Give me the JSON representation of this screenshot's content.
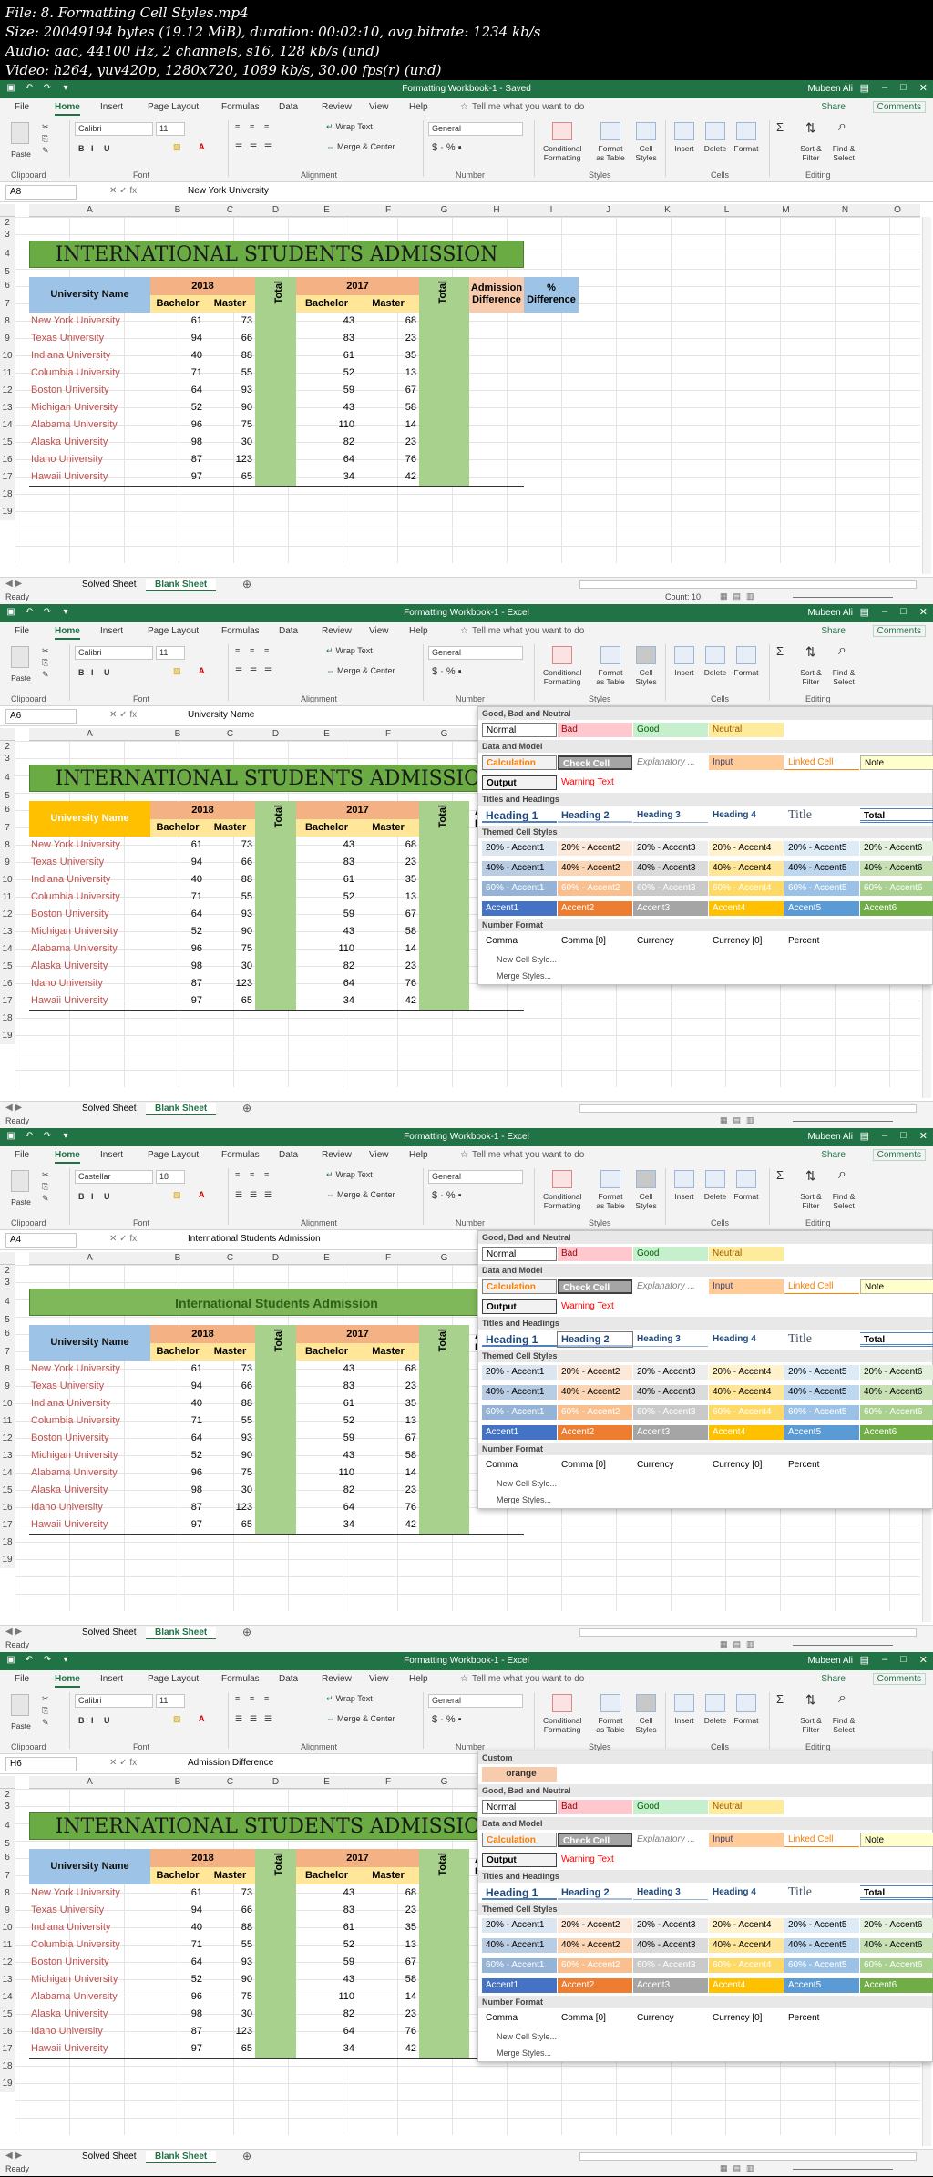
{
  "video_info": [
    "File: 8. Formatting Cell Styles.mp4",
    "Size: 20049194 bytes (19.12 MiB), duration: 00:02:10, avg.bitrate: 1234 kb/s",
    "Audio: aac, 44100 Hz, 2 channels, s16, 128 kb/s (und)",
    "Video: h264, yuv420p, 1280x720, 1089 kb/s, 30.00 fps(r) (und)"
  ],
  "app": {
    "user": "Mubeen Ali",
    "tabs": [
      "File",
      "Home",
      "Insert",
      "Page Layout",
      "Formulas",
      "Data",
      "Review",
      "View",
      "Help"
    ],
    "tell_me": "Tell me what you want to do",
    "share": "Share",
    "comments": "Comments",
    "ribbon": {
      "paste": "Paste",
      "clipboard": "Clipboard",
      "font_group": "Font",
      "alignment": "Alignment",
      "wrap_text": "Wrap Text",
      "merge_center": "Merge & Center",
      "number_format": "General",
      "number": "Number",
      "styles": "Styles",
      "cells": "Cells",
      "editing": "Editing",
      "conditional": "Conditional Formatting",
      "format_table": "Format as Table",
      "cell_styles": "Cell Styles",
      "insert": "Insert",
      "delete": "Delete",
      "format": "Format",
      "sort_filter": "Sort & Filter",
      "find_select": "Find & Select"
    },
    "sheets": [
      "Solved Sheet",
      "Blank Sheet"
    ],
    "status_ready": "Ready"
  },
  "columns": [
    "A",
    "B",
    "C",
    "D",
    "E",
    "F",
    "G",
    "H",
    "I",
    "J",
    "K",
    "L",
    "M",
    "N",
    "O"
  ],
  "table": {
    "title": "INTERNATIONAL STUDENTS ADMISSION",
    "title_alt": "International Students Admission",
    "university": "University Name",
    "year_2018": "2018",
    "year_2017": "2017",
    "bachelor": "Bachelor",
    "master": "Master",
    "total": "Total",
    "admission_diff": "Admission Difference",
    "pct_diff": "% Difference",
    "rows": [
      {
        "name": "New York University",
        "b18": "61",
        "m18": "73",
        "b17": "43",
        "m17": "68"
      },
      {
        "name": "Texas University",
        "b18": "94",
        "m18": "66",
        "b17": "83",
        "m17": "23"
      },
      {
        "name": "Indiana University",
        "b18": "40",
        "m18": "88",
        "b17": "61",
        "m17": "35"
      },
      {
        "name": "Columbia University",
        "b18": "71",
        "m18": "55",
        "b17": "52",
        "m17": "13"
      },
      {
        "name": "Boston University",
        "b18": "64",
        "m18": "93",
        "b17": "59",
        "m17": "67"
      },
      {
        "name": "Michigan University",
        "b18": "52",
        "m18": "90",
        "b17": "43",
        "m17": "58"
      },
      {
        "name": "Alabama University",
        "b18": "96",
        "m18": "75",
        "b17": "110",
        "m17": "14"
      },
      {
        "name": "Alaska University",
        "b18": "98",
        "m18": "30",
        "b17": "82",
        "m17": "23"
      },
      {
        "name": "Idaho University",
        "b18": "87",
        "m18": "123",
        "b17": "64",
        "m17": "76"
      },
      {
        "name": "Hawaii University",
        "b18": "97",
        "m18": "65",
        "b17": "34",
        "m17": "42"
      }
    ]
  },
  "frames": [
    {
      "title": "Formatting Workbook-1 - Saved",
      "namebox": "A8",
      "formula": "New York University",
      "font": "Calibri",
      "size": "11",
      "count": "Count: 10"
    },
    {
      "title": "Formatting Workbook-1 - Excel",
      "namebox": "A6",
      "formula": "University Name",
      "font": "Calibri",
      "size": "11",
      "count": ""
    },
    {
      "title": "Formatting Workbook-1 - Excel",
      "namebox": "A4",
      "formula": "International Students Admission",
      "font": "Castellar",
      "size": "18",
      "count": ""
    },
    {
      "title": "Formatting Workbook-1 - Excel",
      "namebox": "H6",
      "formula": "Admission Difference",
      "font": "Calibri",
      "size": "11",
      "count": ""
    }
  ],
  "cell_styles": {
    "custom": "Custom",
    "custom_orange": "orange",
    "good_bad_neutral": "Good, Bad and Neutral",
    "normal": "Normal",
    "bad": "Bad",
    "good": "Good",
    "neutral": "Neutral",
    "data_model": "Data and Model",
    "calculation": "Calculation",
    "check_cell": "Check Cell",
    "explanatory": "Explanatory ...",
    "input": "Input",
    "linked_cell": "Linked Cell",
    "note": "Note",
    "output": "Output",
    "warning": "Warning Text",
    "titles_headings": "Titles and Headings",
    "h1": "Heading 1",
    "h2": "Heading 2",
    "h3": "Heading 3",
    "h4": "Heading 4",
    "title": "Title",
    "total": "Total",
    "themed": "Themed Cell Styles",
    "p20": [
      "20% - Accent1",
      "20% - Accent2",
      "20% - Accent3",
      "20% - Accent4",
      "20% - Accent5",
      "20% - Accent6"
    ],
    "p40": [
      "40% - Accent1",
      "40% - Accent2",
      "40% - Accent3",
      "40% - Accent4",
      "40% - Accent5",
      "40% - Accent6"
    ],
    "p60": [
      "60% - Accent1",
      "60% - Accent2",
      "60% - Accent3",
      "60% - Accent4",
      "60% - Accent5",
      "60% - Accent6"
    ],
    "acc": [
      "Accent1",
      "Accent2",
      "Accent3",
      "Accent4",
      "Accent5",
      "Accent6"
    ],
    "number_format": "Number Format",
    "comma": "Comma",
    "comma0": "Comma [0]",
    "currency": "Currency",
    "currency0": "Currency [0]",
    "percent": "Percent",
    "new_style": "New Cell Style...",
    "merge_styles": "Merge Styles..."
  },
  "colors": {
    "excel_green": "#217346",
    "title_green": "#6aab44",
    "uni_blue": "#9dc3e6",
    "year_orange": "#f4b183",
    "sub_yellow": "#ffe699",
    "total_green": "#a9d18e",
    "uni_red": "#c0504d"
  }
}
